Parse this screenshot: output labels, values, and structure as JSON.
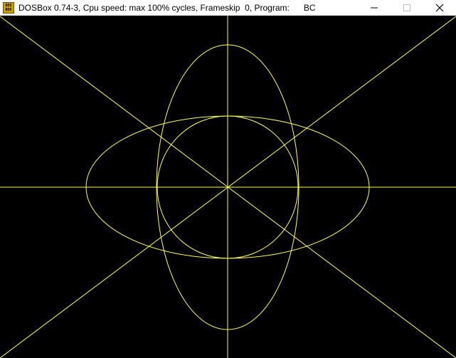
{
  "window": {
    "title": "DOSBox 0.74-3, Cpu speed: max 100% cycles, Frameskip  0, Program:      BC",
    "icon_label_top": "DOS",
    "icon_label_bottom": "BOX",
    "icon": "dosbox-icon",
    "controls": [
      "minimize-icon",
      "maximize-icon",
      "close-icon"
    ]
  },
  "screen": {
    "background": "#000000",
    "line_color": "#ffff55"
  }
}
